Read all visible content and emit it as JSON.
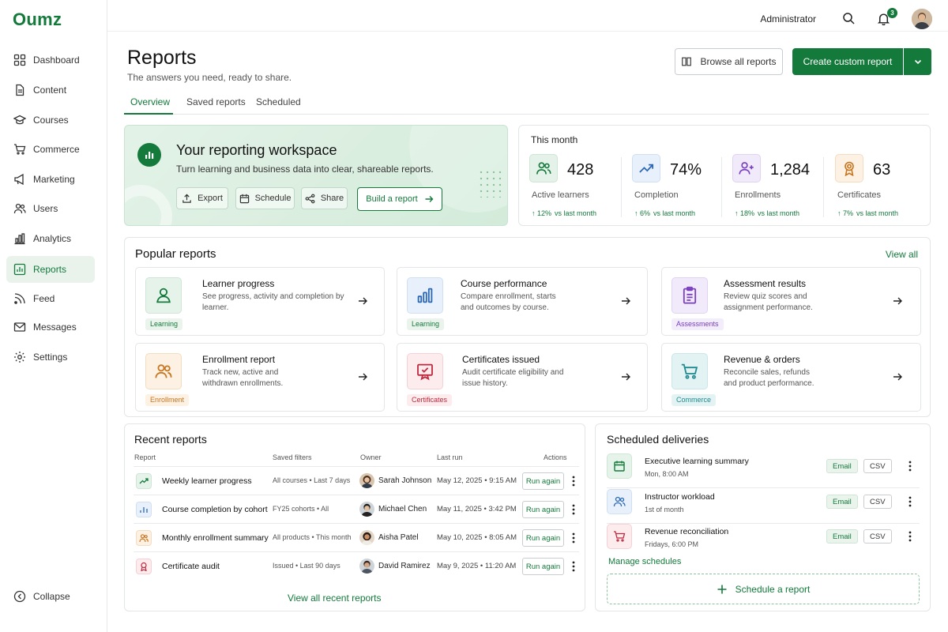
{
  "app": {
    "logo": "Oumz"
  },
  "sidebar": {
    "items": [
      {
        "label": "Dashboard",
        "icon": "grid-icon"
      },
      {
        "label": "Content",
        "icon": "document-icon"
      },
      {
        "label": "Courses",
        "icon": "graduation-cap-icon"
      },
      {
        "label": "Commerce",
        "icon": "cart-icon"
      },
      {
        "label": "Marketing",
        "icon": "megaphone-icon"
      },
      {
        "label": "Users",
        "icon": "users-icon"
      },
      {
        "label": "Analytics",
        "icon": "bar-chart-icon"
      },
      {
        "label": "Reports",
        "icon": "report-chart-icon",
        "active": true
      },
      {
        "label": "Feed",
        "icon": "rss-icon"
      },
      {
        "label": "Messages",
        "icon": "mail-icon"
      },
      {
        "label": "Settings",
        "icon": "gear-icon"
      }
    ],
    "collapse_label": "Collapse"
  },
  "topbar": {
    "user_role": "Administrator",
    "notification_count": "3"
  },
  "page": {
    "title": "Reports",
    "subtitle": "The answers you need, ready to share.",
    "browse_label": "Browse all reports",
    "create_label": "Create custom report",
    "tabs": [
      "Overview",
      "Saved reports",
      "Scheduled"
    ]
  },
  "hero": {
    "title": "Your reporting workspace",
    "subtitle": "Turn learning and business data into clear, shareable reports.",
    "export_label": "Export",
    "schedule_label": "Schedule",
    "share_label": "Share",
    "build_label": "Build a report"
  },
  "month": {
    "title": "This month",
    "stats": [
      {
        "value": "428",
        "label": "Active learners",
        "delta": "12%",
        "vs": "vs last month"
      },
      {
        "value": "74%",
        "label": "Completion",
        "delta": "6%",
        "vs": "vs last month"
      },
      {
        "value": "1,284",
        "label": "Enrollments",
        "delta": "18%",
        "vs": "vs last month"
      },
      {
        "value": "63",
        "label": "Certificates",
        "delta": "7%",
        "vs": "vs last month"
      }
    ]
  },
  "popular": {
    "title": "Popular reports",
    "view_all": "View all",
    "cards": [
      {
        "title": "Learner progress",
        "desc": "See progress, activity and completion by learner.",
        "tag": "Learning"
      },
      {
        "title": "Course performance",
        "desc": "Compare enrollment, starts and outcomes by course.",
        "tag": "Learning"
      },
      {
        "title": "Assessment results",
        "desc": "Review quiz scores and assignment performance.",
        "tag": "Assessments"
      },
      {
        "title": "Enrollment report",
        "desc": "Track new, active and withdrawn enrollments.",
        "tag": "Enrollment"
      },
      {
        "title": "Certificates issued",
        "desc": "Audit certificate eligibility and issue history.",
        "tag": "Certificates"
      },
      {
        "title": "Revenue & orders",
        "desc": "Reconcile sales, refunds and product performance.",
        "tag": "Commerce"
      }
    ]
  },
  "recent": {
    "title": "Recent reports",
    "headers": {
      "report": "Report",
      "filters": "Saved filters",
      "owner": "Owner",
      "last_run": "Last run",
      "actions": "Actions"
    },
    "rows": [
      {
        "name": "Weekly learner progress",
        "filters": "All courses  •  Last 7 days",
        "owner": "Sarah Johnson",
        "date": "May 12, 2025  •  9:15 AM",
        "action": "Run again"
      },
      {
        "name": "Course completion by cohort",
        "filters": "FY25 cohorts  •  All",
        "owner": "Michael Chen",
        "date": "May 11, 2025  •  3:42 PM",
        "action": "Run again"
      },
      {
        "name": "Monthly enrollment summary",
        "filters": "All products  •  This month",
        "owner": "Aisha Patel",
        "date": "May 10, 2025  •  8:05 AM",
        "action": "Run again"
      },
      {
        "name": "Certificate audit",
        "filters": "Issued  •  Last 90 days",
        "owner": "David Ramirez",
        "date": "May 9, 2025  •  11:20 AM",
        "action": "Run again"
      }
    ],
    "view_all": "View all recent reports"
  },
  "scheduled": {
    "title": "Scheduled deliveries",
    "rows": [
      {
        "name": "Executive learning summary",
        "time": "Mon, 8:00 AM",
        "channel": "Email",
        "format": "CSV"
      },
      {
        "name": "Instructor workload",
        "time": "1st of month",
        "channel": "Email",
        "format": "CSV"
      },
      {
        "name": "Revenue reconciliation",
        "time": "Fridays, 6:00 PM",
        "channel": "Email",
        "format": "CSV"
      }
    ],
    "manage_label": "Manage schedules",
    "add_label": "Schedule a report"
  },
  "colors": {
    "brand": "#137a3b",
    "active_bg": "#e9f3ec"
  }
}
